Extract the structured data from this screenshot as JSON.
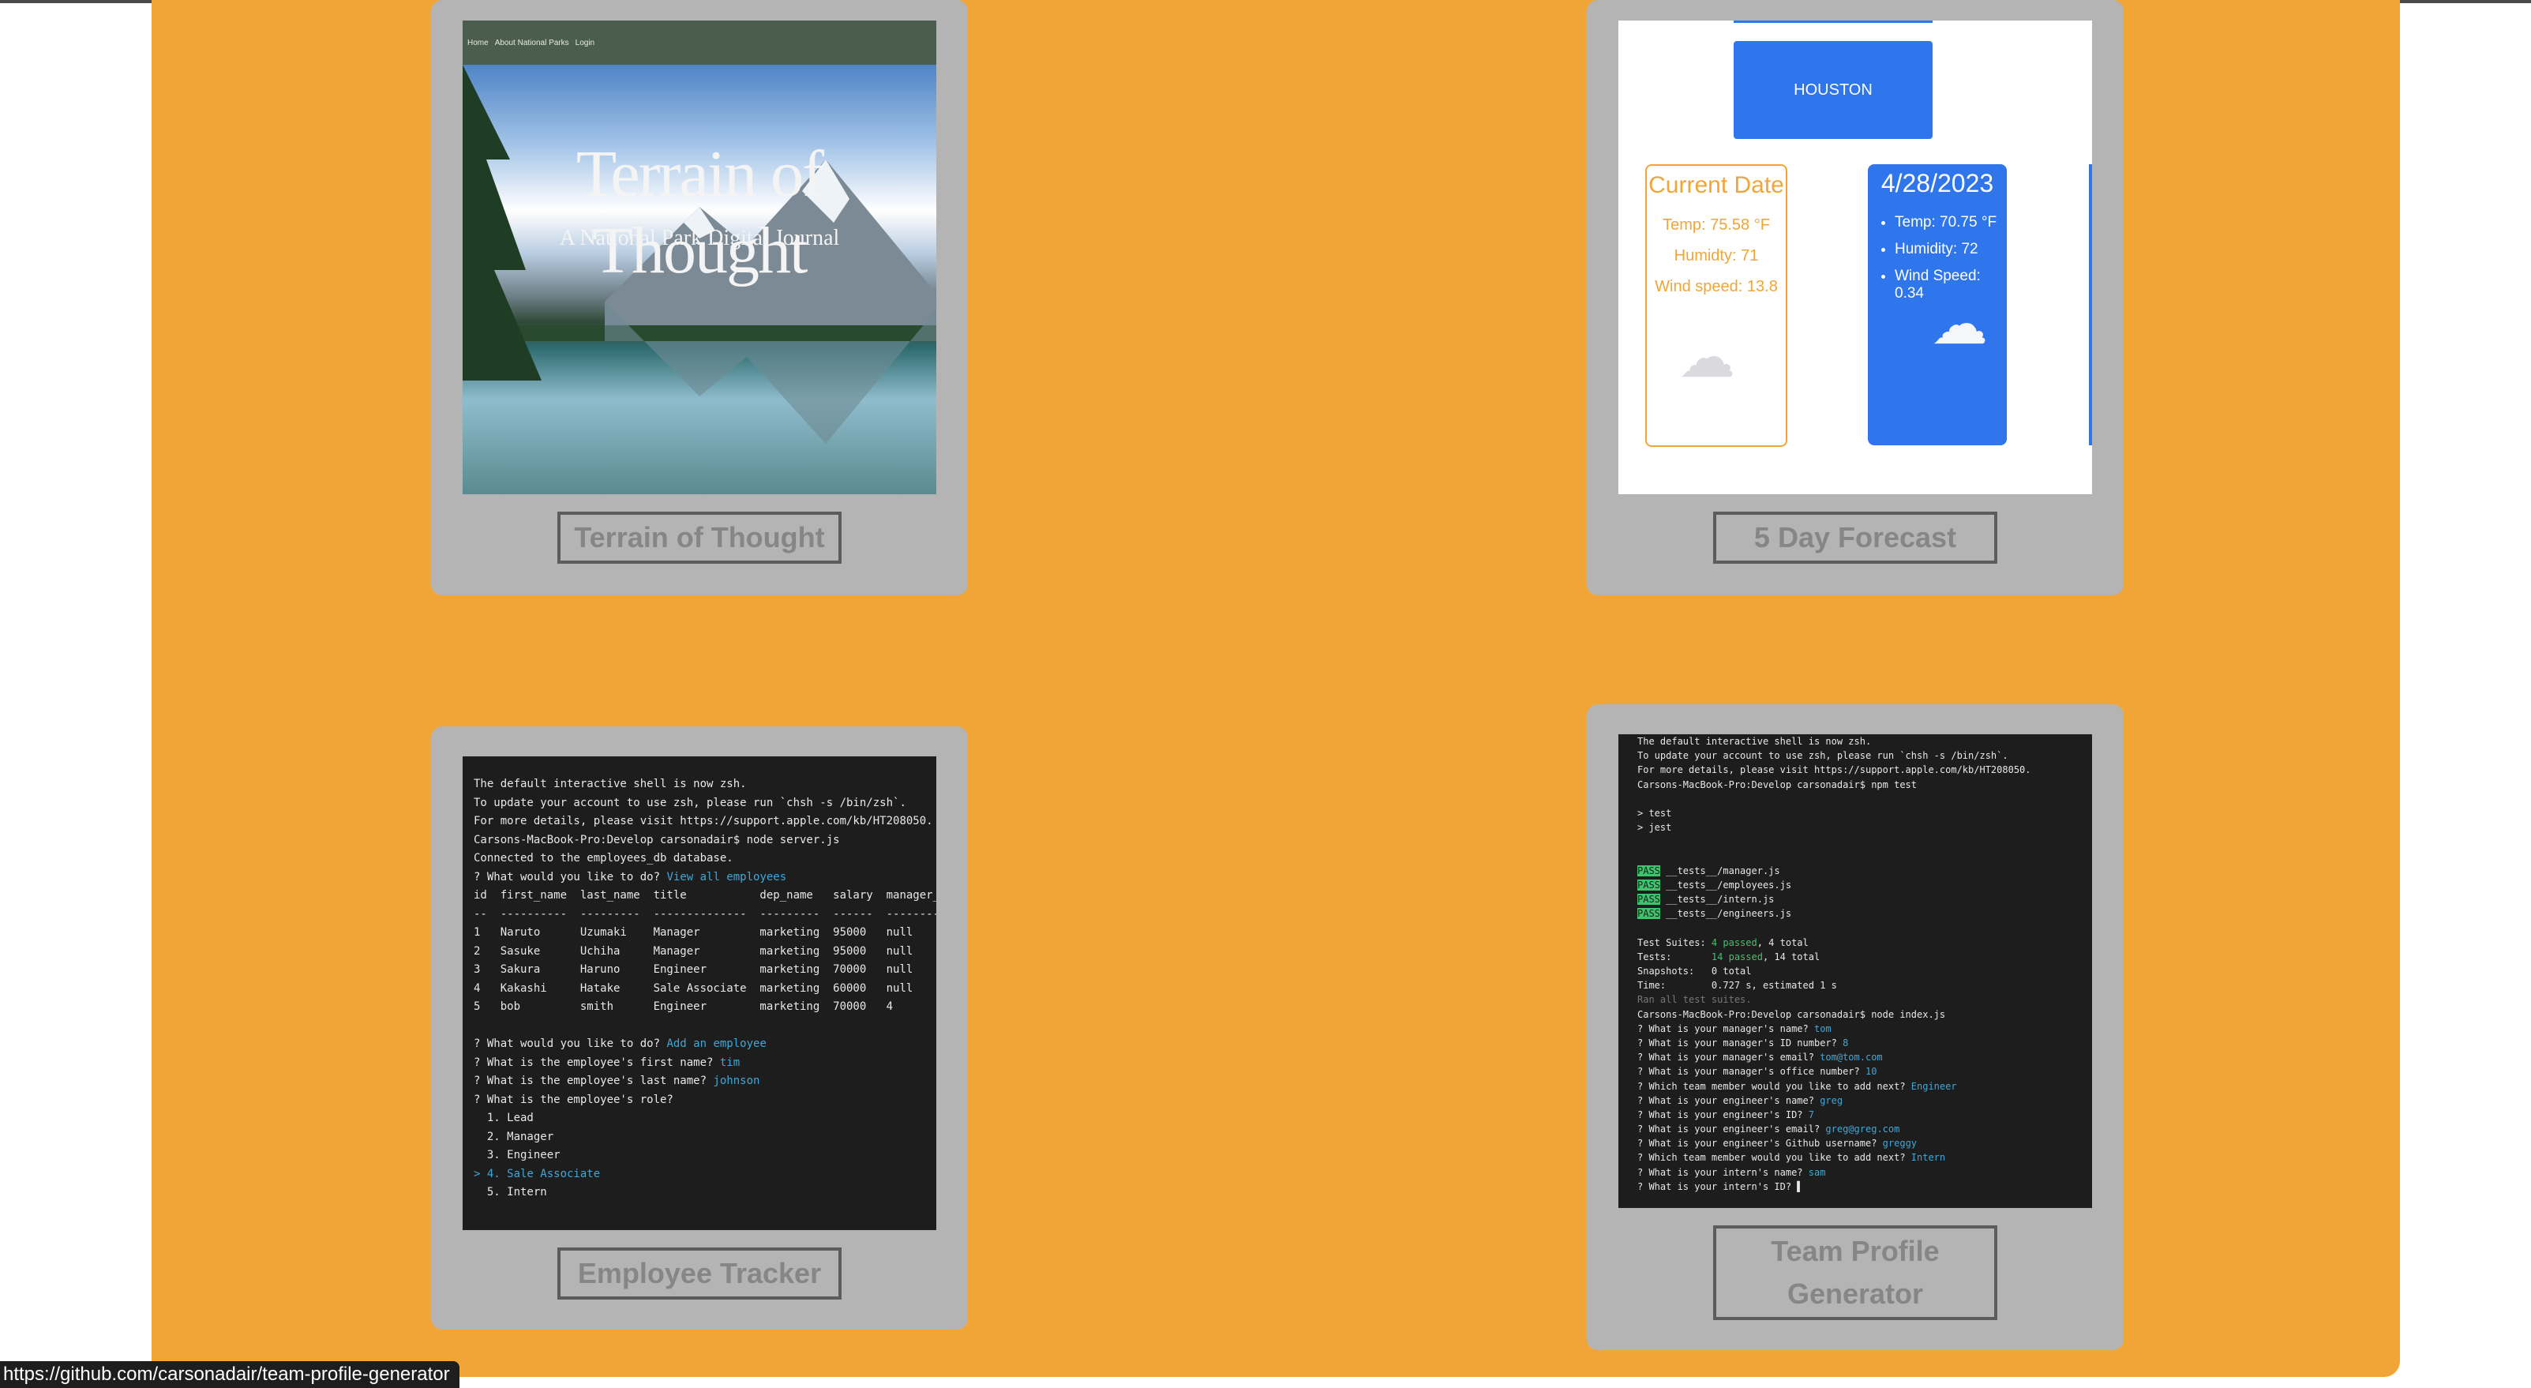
{
  "cards": [
    {
      "title": "Terrain of Thought",
      "nav": [
        "Home",
        "About National Parks",
        "Login"
      ],
      "hero_title": "Terrain of Thought",
      "hero_subtitle": "A National Park Digital Journal"
    },
    {
      "title": "5 Day Forecast",
      "city": "HOUSTON",
      "current": {
        "heading": "Current Date",
        "temp": "Temp: 75.58 °F",
        "humidity": "Humidty: 71",
        "wind": "Wind speed: 13.8"
      },
      "day1": {
        "date": "4/28/2023",
        "temp": "Temp: 70.75 °F",
        "humidity": "Humidity: 72",
        "wind": "Wind Speed: 0.34"
      }
    },
    {
      "title": "Employee Tracker",
      "terminal": [
        {
          "t": "The default interactive shell is now zsh."
        },
        {
          "t": "To update your account to use zsh, please run `chsh -s /bin/zsh`."
        },
        {
          "t": "For more details, please visit https://support.apple.com/kb/HT208050."
        },
        {
          "t": "Carsons-MacBook-Pro:Develop carsonadair$ node server.js"
        },
        {
          "t": "Connected to the employees_db database."
        },
        {
          "t": "? What would you like to do? ",
          "a": "View all employees"
        },
        {
          "t": "id  first_name  last_name  title           dep_name   salary  manager_id"
        },
        {
          "t": "--  ----------  ---------  --------------  ---------  ------  ----------"
        },
        {
          "t": "1   Naruto      Uzumaki    Manager         marketing  95000   null"
        },
        {
          "t": "2   Sasuke      Uchiha     Manager         marketing  95000   null"
        },
        {
          "t": "3   Sakura      Haruno     Engineer        marketing  70000   null"
        },
        {
          "t": "4   Kakashi     Hatake     Sale Associate  marketing  60000   null"
        },
        {
          "t": "5   bob         smith      Engineer        marketing  70000   4"
        },
        {
          "t": ""
        },
        {
          "t": "? What would you like to do? ",
          "a": "Add an employee"
        },
        {
          "t": "? What is the employee's first name? ",
          "a": "tim"
        },
        {
          "t": "? What is the employee's last name? ",
          "a": "johnson"
        },
        {
          "t": "? What is the employee's role?"
        },
        {
          "t": "  1. Lead"
        },
        {
          "t": "  2. Manager"
        },
        {
          "t": "  3. Engineer"
        },
        {
          "t": "",
          "a": "> 4. Sale Associate"
        },
        {
          "t": "  5. Intern"
        }
      ]
    },
    {
      "title": "Team Profile Generator",
      "terminal": [
        {
          "t": "The default interactive shell is now zsh."
        },
        {
          "t": "To update your account to use zsh, please run `chsh -s /bin/zsh`."
        },
        {
          "t": "For more details, please visit https://support.apple.com/kb/HT208050."
        },
        {
          "t": "Carsons-MacBook-Pro:Develop carsonadair$ npm test"
        },
        {
          "t": ""
        },
        {
          "t": "> test"
        },
        {
          "t": "> jest"
        },
        {
          "t": ""
        },
        {
          "t": ""
        },
        {
          "b": "PASS",
          "t": " __tests__/manager.js"
        },
        {
          "b": "PASS",
          "t": " __tests__/employees.js"
        },
        {
          "b": "PASS",
          "t": " __tests__/intern.js"
        },
        {
          "b": "PASS",
          "t": " __tests__/engineers.js"
        },
        {
          "t": ""
        },
        {
          "t": "Test Suites: ",
          "g": "4 passed",
          "r": ", 4 total"
        },
        {
          "t": "Tests:       ",
          "g": "14 passed",
          "r": ", 14 total"
        },
        {
          "t": "Snapshots:   0 total"
        },
        {
          "t": "Time:        0.727 s, estimated 1 s"
        },
        {
          "d": "Ran all test suites."
        },
        {
          "t": "Carsons-MacBook-Pro:Develop carsonadair$ node index.js"
        },
        {
          "t": "? What is your manager's name? ",
          "a": "tom"
        },
        {
          "t": "? What is your manager's ID number? ",
          "a": "8"
        },
        {
          "t": "? What is your manager's email? ",
          "a": "tom@tom.com"
        },
        {
          "t": "? What is your manager's office number? ",
          "a": "10"
        },
        {
          "t": "? Which team member would you like to add next? ",
          "a": "Engineer"
        },
        {
          "t": "? What is your engineer's name? ",
          "a": "greg"
        },
        {
          "t": "? What is your engineer's ID? ",
          "a": "7"
        },
        {
          "t": "? What is your engineer's email? ",
          "a": "greg@greg.com"
        },
        {
          "t": "? What is your engineer's Github username? ",
          "a": "greggy"
        },
        {
          "t": "? Which team member would you like to add next? ",
          "a": "Intern"
        },
        {
          "t": "? What is your intern's name? ",
          "a": "sam"
        },
        {
          "t": "? What is your intern's ID? ▌"
        }
      ]
    }
  ],
  "status_url": "https://github.com/carsonadair/team-profile-generator",
  "colors": {
    "panel": "#f2a537",
    "card": "#b4b4b4",
    "accent_blue": "#2f75ec"
  }
}
